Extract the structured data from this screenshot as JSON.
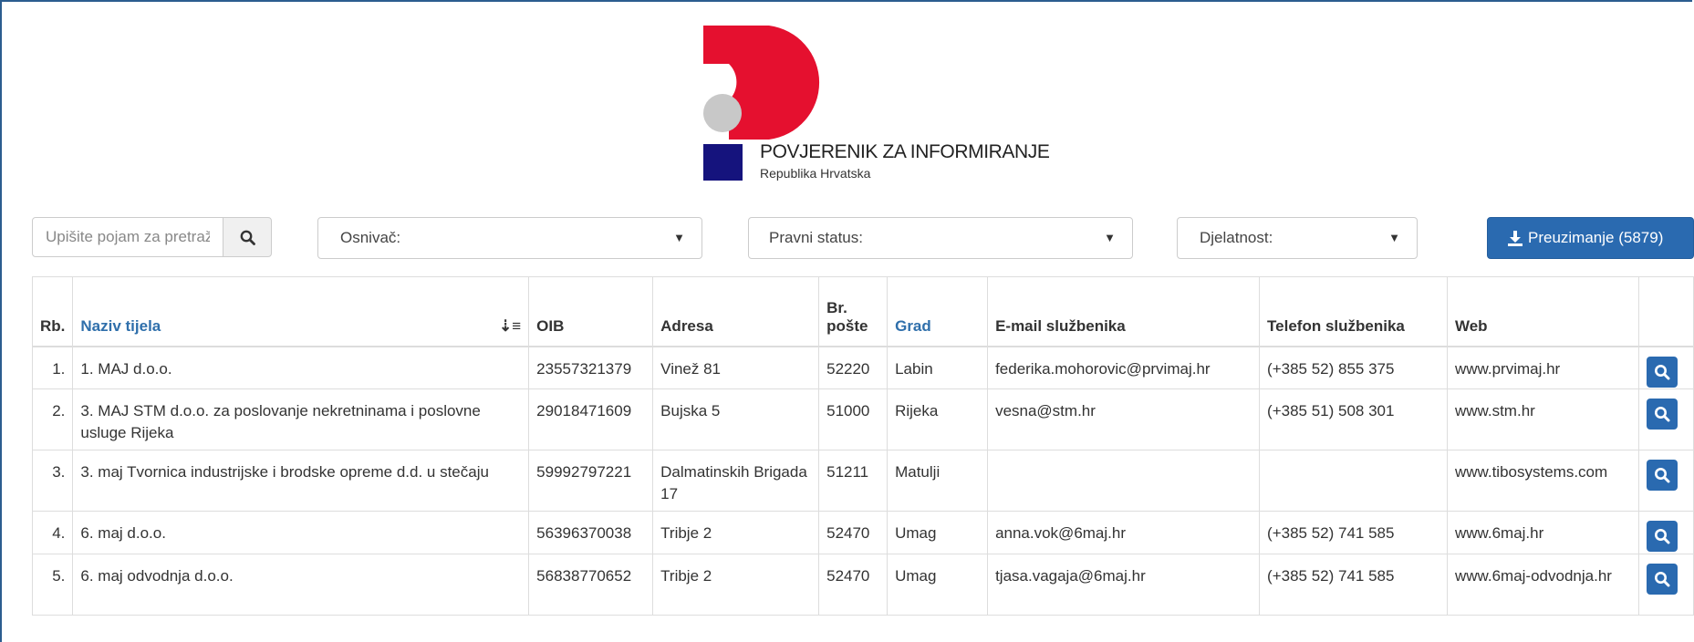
{
  "logo": {
    "title": "POVJERENIK ZA INFORMIRANJE",
    "subtitle": "Republika Hrvatska",
    "colors": {
      "red": "#e5102f",
      "grey": "#c8c8c8",
      "navy": "#15137d"
    }
  },
  "filters": {
    "search_placeholder": "Upišite pojam za pretraživanje",
    "search_icon": "search-icon",
    "osnivac_label": "Osnivač:",
    "pravni_status_label": "Pravni status:",
    "djelatnost_label": "Djelatnost:",
    "download_label": "Preuzimanje (5879)",
    "download_icon": "download-icon",
    "accent": "#2a6ab0"
  },
  "table": {
    "headers": {
      "rb": "Rb.",
      "naziv": "Naziv tijela",
      "oib": "OIB",
      "adresa": "Adresa",
      "br_poste_1": "Br.",
      "br_poste_2": "pošte",
      "grad": "Grad",
      "email": "E-mail službenika",
      "telefon": "Telefon službenika",
      "web": "Web"
    },
    "rows": [
      {
        "rb": "1.",
        "naziv": "1. MAJ d.o.o.",
        "oib": "23557321379",
        "adresa": "Vinež 81",
        "posta": "52220",
        "grad": "Labin",
        "email": "federika.mohorovic@prvimaj.hr",
        "telefon": "(+385 52) 855 375",
        "web": "www.prvimaj.hr"
      },
      {
        "rb": "2.",
        "naziv": "3. MAJ STM d.o.o. za poslovanje nekretninama i poslovne usluge Rijeka",
        "oib": "29018471609",
        "adresa": "Bujska 5",
        "posta": "51000",
        "grad": "Rijeka",
        "email": "vesna@stm.hr",
        "telefon": "(+385 51) 508 301",
        "web": "www.stm.hr"
      },
      {
        "rb": "3.",
        "naziv": "3. maj Tvornica industrijske i brodske opreme d.d. u stečaju",
        "oib": "59992797221",
        "adresa": "Dalmatinskih Brigada 17",
        "posta": "51211",
        "grad": "Matulji",
        "email": "",
        "telefon": "",
        "web": "www.tibosystems.com"
      },
      {
        "rb": "4.",
        "naziv": "6. maj d.o.o.",
        "oib": "56396370038",
        "adresa": "Tribje 2",
        "posta": "52470",
        "grad": "Umag",
        "email": "anna.vok@6maj.hr",
        "telefon": "(+385 52) 741 585",
        "web": "www.6maj.hr"
      },
      {
        "rb": "5.",
        "naziv": "6. maj odvodnja d.o.o.",
        "oib": "56838770652",
        "adresa": "Tribje 2",
        "posta": "52470",
        "grad": "Umag",
        "email": "tjasa.vagaja@6maj.hr",
        "telefon": "(+385 52) 741 585",
        "web": "www.6maj-odvodnja.hr"
      }
    ]
  }
}
